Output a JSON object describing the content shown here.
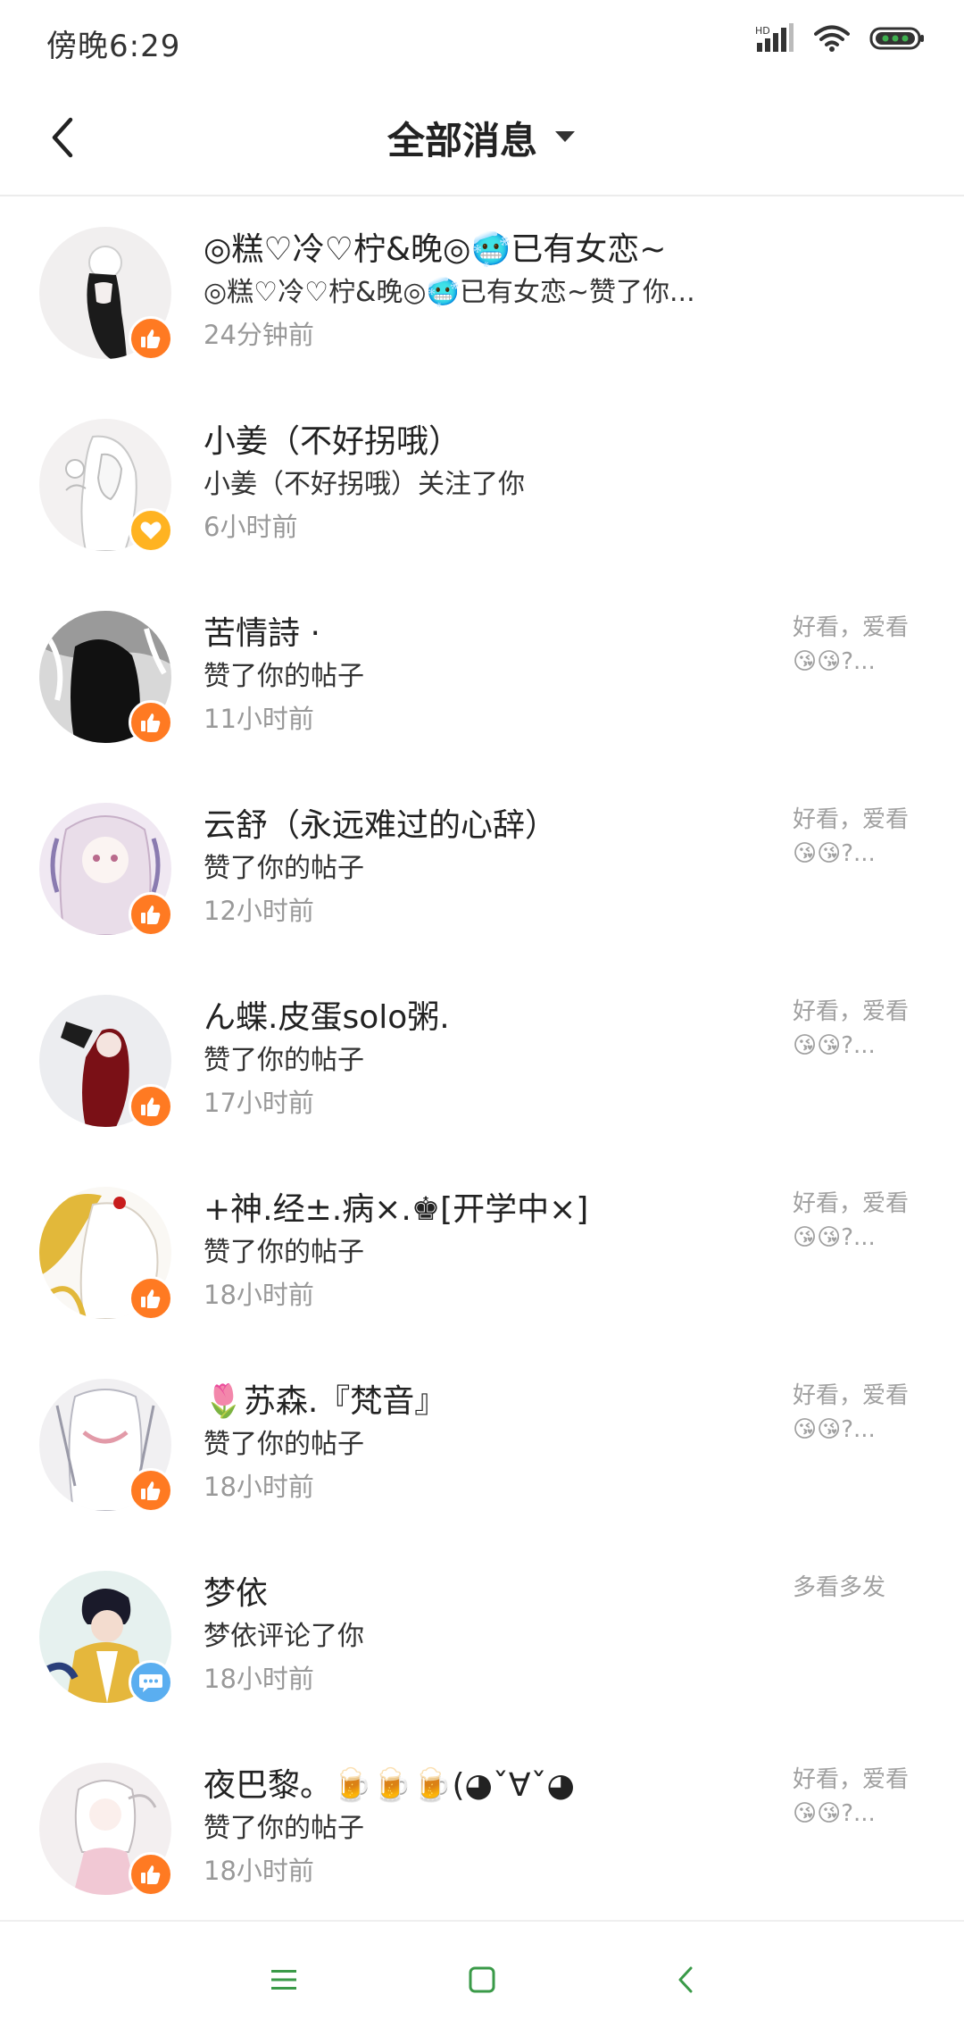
{
  "status_bar": {
    "time": "傍晚6:29",
    "signal_label": "HD",
    "icons": [
      "signal-icon",
      "wifi-icon",
      "battery-icon"
    ]
  },
  "header": {
    "title": "全部消息",
    "back_icon": "back-arrow-icon",
    "dropdown_icon": "triangle-down-icon"
  },
  "messages": [
    {
      "name": "◎糕♡冷♡柠&晚◎🥶已有女恋~",
      "text": "◎糕♡冷♡柠&晚◎🥶已有女恋~赞了你...",
      "time": "24分钟前",
      "preview": "",
      "badge": "like"
    },
    {
      "name": "小姜（不好拐哦）",
      "text": "小姜（不好拐哦）关注了你",
      "time": "6小时前",
      "preview": "",
      "badge": "follow"
    },
    {
      "name": "苦情詩 ·",
      "text": "赞了你的帖子",
      "time": "11小时前",
      "preview": "好看，爱看😘😘?...",
      "badge": "like"
    },
    {
      "name": "云舒（永远难过的心辞）",
      "text": "赞了你的帖子",
      "time": "12小时前",
      "preview": "好看，爱看😘😘?...",
      "badge": "like"
    },
    {
      "name": "ん蝶.皮蛋solo粥.",
      "text": "赞了你的帖子",
      "time": "17小时前",
      "preview": "好看，爱看😘😘?...",
      "badge": "like"
    },
    {
      "name": "+神.经±.病×.♚[开学中×]",
      "text": "赞了你的帖子",
      "time": "18小时前",
      "preview": "好看，爱看😘😘?...",
      "badge": "like"
    },
    {
      "name": "🌷苏森.『梵音』",
      "text": "赞了你的帖子",
      "time": "18小时前",
      "preview": "好看，爱看😘😘?...",
      "badge": "like"
    },
    {
      "name": "梦依",
      "text": "梦依评论了你",
      "time": "18小时前",
      "preview": "多看多发",
      "badge": "comment"
    },
    {
      "name": "夜巴黎。🍺🍺🍺(◕ˇ∀ˇ◕",
      "text": "赞了你的帖子",
      "time": "18小时前",
      "preview": "好看，爱看😘😘?...",
      "badge": "like"
    }
  ],
  "nav_bar": {
    "icons": [
      "menu-icon",
      "home-square-icon",
      "back-chevron-icon"
    ]
  },
  "colors": {
    "like_badge": "#ff7a22",
    "follow_badge": "#ffb321",
    "comment_badge": "#5aaef0",
    "nav_icon": "#3a9a48",
    "secondary_text": "#999999"
  }
}
